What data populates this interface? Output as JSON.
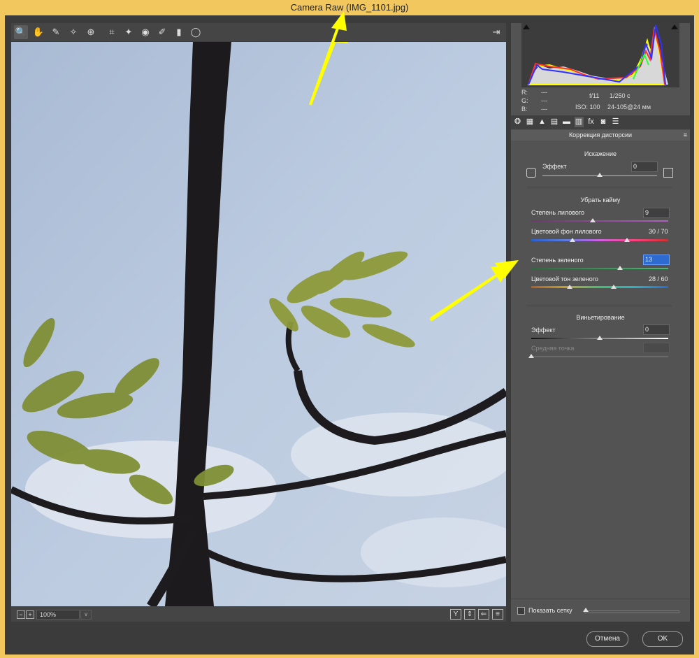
{
  "window": {
    "title": "Camera Raw (IMG_1101.jpg)"
  },
  "toolbar": {
    "tools": [
      {
        "name": "zoom-icon",
        "glyph": "🔍"
      },
      {
        "name": "hand-icon",
        "glyph": "✋"
      },
      {
        "name": "white-balance-icon",
        "glyph": "✎"
      },
      {
        "name": "color-sampler-icon",
        "glyph": "✧"
      },
      {
        "name": "target-adjust-icon",
        "glyph": "⊕"
      },
      {
        "name": "crop-icon",
        "glyph": "⌗"
      },
      {
        "name": "spot-removal-icon",
        "glyph": "✦"
      },
      {
        "name": "red-eye-icon",
        "glyph": "◉"
      },
      {
        "name": "adjustment-brush-icon",
        "glyph": "✐"
      },
      {
        "name": "graduated-filter-icon",
        "glyph": "▮"
      },
      {
        "name": "radial-filter-icon",
        "glyph": "◯"
      }
    ],
    "export_icon": "⇥"
  },
  "bottom": {
    "zoom": "100%",
    "zoom_out": "−",
    "zoom_in": "+",
    "caret": "∨",
    "view_buttons": [
      "Y",
      "⇕",
      "⇐",
      "≡"
    ]
  },
  "info": {
    "r_label": "R:",
    "r_val": "---",
    "g_label": "G:",
    "g_val": "---",
    "b_label": "B:",
    "b_val": "---",
    "aperture": "f/11",
    "shutter": "1/250 с",
    "iso": "ISO: 100",
    "lens": "24-105@24 мм"
  },
  "tabs": [
    "❂",
    "▦",
    "▲",
    "▤",
    "▬",
    "▥",
    "fx",
    "◙",
    "☰"
  ],
  "panel_title": "Коррекция дисторсии",
  "panel_menu": "≡",
  "distortion": {
    "header": "Искажение",
    "effect_label": "Эффект",
    "effect_value": "0",
    "level": 0.5
  },
  "fringe": {
    "header": "Убрать кайму",
    "purple_amount_label": "Степень лилового",
    "purple_amount_value": "9",
    "purple_amount_level": 0.45,
    "purple_hue_label": "Цветовой фон лилового",
    "purple_hue_value": "30 / 70",
    "purple_hue_low": 0.3,
    "purple_hue_high": 0.7,
    "green_amount_label": "Степень зеленого",
    "green_amount_value": "13",
    "green_amount_level": 0.65,
    "green_hue_label": "Цветовой тон зеленого",
    "green_hue_value": "28 / 60",
    "green_hue_low": 0.28,
    "green_hue_high": 0.6
  },
  "vignette": {
    "header": "Виньетирование",
    "effect_label": "Эффект",
    "effect_value": "0",
    "effect_level": 0.5,
    "midpoint_label": "Средняя точка",
    "midpoint_value": "",
    "midpoint_level": 0.0
  },
  "grid": {
    "label": "Показать сетку",
    "checked": false
  },
  "buttons": {
    "cancel": "Отмена",
    "ok": "OK"
  },
  "annotation_color": "#ffff00"
}
